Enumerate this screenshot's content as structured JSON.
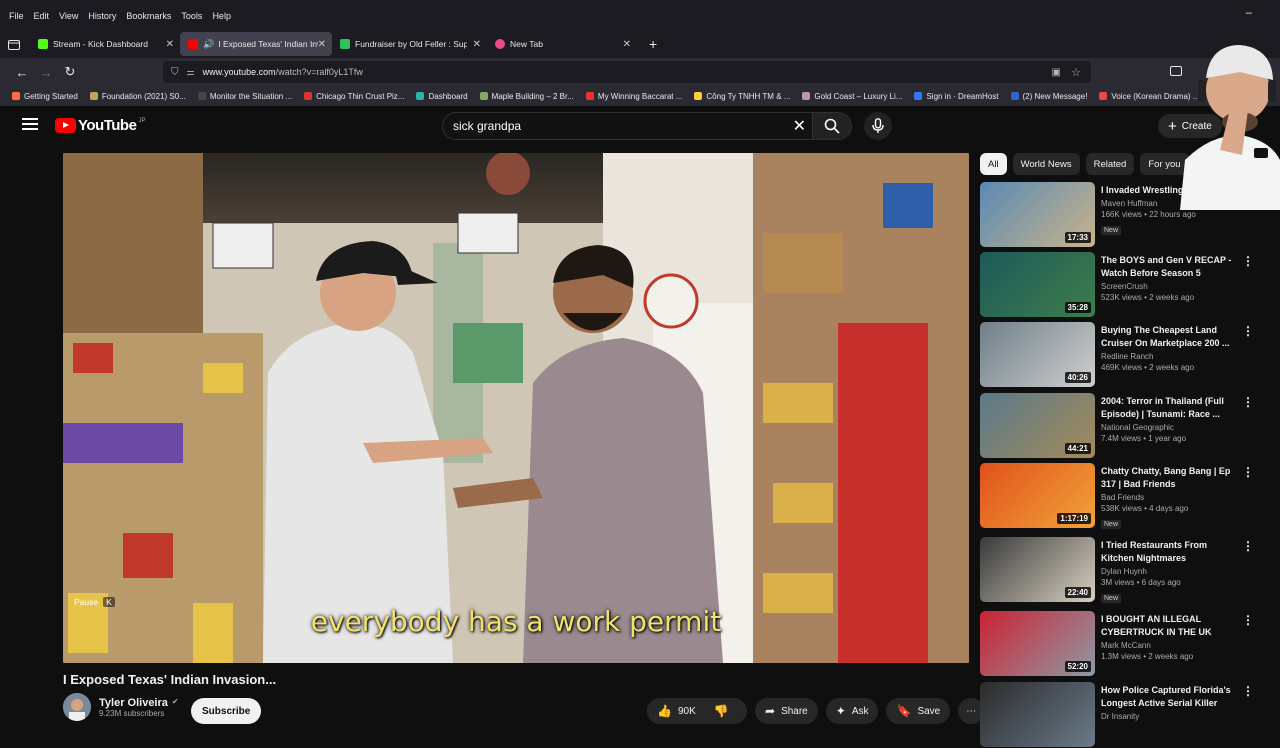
{
  "menu": [
    "File",
    "Edit",
    "View",
    "History",
    "Bookmarks",
    "Tools",
    "Help"
  ],
  "window_minimize": "–",
  "tabs": [
    {
      "label": "Stream - Kick Dashboard",
      "color": "#53fc18"
    },
    {
      "label": "I Exposed Texas' Indian Inva",
      "color": "#ff0000",
      "active": true
    },
    {
      "label": "Fundraiser by Old Feller : Supp",
      "color": "#2dc25b"
    },
    {
      "label": "New Tab",
      "color": "#e74c8b"
    }
  ],
  "url": {
    "host": "www.youtube.com",
    "path": "/watch?v=ralf0yL1Tfw"
  },
  "bookmarks": [
    {
      "label": "Getting Started",
      "color": "#ff7139"
    },
    {
      "label": "Foundation (2021) S0...",
      "color": "#c4a35a"
    },
    {
      "label": "Monitor the Situation ...",
      "color": "#444"
    },
    {
      "label": "Chicago Thin Crust Piz...",
      "color": "#d33"
    },
    {
      "label": "Dashboard",
      "color": "#2bb3a3"
    },
    {
      "label": "Maple Building – 2 Br...",
      "color": "#8a6"
    },
    {
      "label": "My Winning Baccarat ...",
      "color": "#e33"
    },
    {
      "label": "Công Ty TNHH TM & ...",
      "color": "#fc3"
    },
    {
      "label": "Gold Coast – Luxury Li...",
      "color": "#b9a"
    },
    {
      "label": "Sign in · DreamHost",
      "color": "#37f"
    },
    {
      "label": "(2) New Message!",
      "color": "#36c"
    },
    {
      "label": "Voice (Korean Drama) ...",
      "color": "#e44"
    }
  ],
  "youtube": {
    "logo_text": "YouTube",
    "country_code": "JP",
    "search_value": "sick grandpa",
    "create_label": "Create"
  },
  "video": {
    "caption": "everybody has a work permit",
    "pause_label": "Pause",
    "pause_key": "K",
    "title": "I Exposed Texas' Indian Invasion...",
    "channel": "Tyler Oliveira",
    "subscribers": "9.23M subscribers",
    "subscribe_label": "Subscribe",
    "likes": "90K",
    "share_label": "Share",
    "ask_label": "Ask",
    "save_label": "Save"
  },
  "chips": [
    "All",
    "World News",
    "Related",
    "For you"
  ],
  "recommendations": [
    {
      "title": "I Invaded Wrestling...",
      "channel": "Maven Huffman",
      "meta": "166K views • 22 hours ago",
      "badge": "New",
      "duration": "17:33",
      "colors": [
        "#5a8ab5",
        "#c9b38a"
      ]
    },
    {
      "title": "The BOYS and Gen V RECAP - Watch Before Season 5",
      "channel": "ScreenCrush",
      "meta": "523K views • 2 weeks ago",
      "badge": "",
      "duration": "35:28",
      "colors": [
        "#1e5a5a",
        "#3d7d4a"
      ]
    },
    {
      "title": "Buying The Cheapest Land Cruiser On Marketplace 200 ...",
      "channel": "Redline Ranch",
      "meta": "469K views • 2 weeks ago",
      "badge": "",
      "duration": "40:26",
      "colors": [
        "#6f7f89",
        "#cfcfcf"
      ]
    },
    {
      "title": "2004: Terror in Thailand (Full Episode) | Tsunami: Race ...",
      "channel": "National Geographic",
      "meta": "7.4M views • 1 year ago",
      "badge": "",
      "duration": "44:21",
      "colors": [
        "#5a7a8a",
        "#a58a5a"
      ]
    },
    {
      "title": "Chatty Chatty, Bang Bang | Ep 317 | Bad Friends",
      "channel": "Bad Friends",
      "meta": "538K views • 4 days ago",
      "badge": "New",
      "duration": "1:17:19",
      "colors": [
        "#e0521a",
        "#f2a33a"
      ]
    },
    {
      "title": "I Tried Restaurants From Kitchen Nightmares",
      "channel": "Dylan Huynh",
      "meta": "3M views • 6 days ago",
      "badge": "New",
      "duration": "22:40",
      "colors": [
        "#3a3a3a",
        "#d7d0c0"
      ]
    },
    {
      "title": "I BOUGHT AN ILLEGAL CYBERTRUCK IN THE UK",
      "channel": "Mark McCann",
      "meta": "1.3M views • 2 weeks ago",
      "badge": "",
      "duration": "52:20",
      "colors": [
        "#c23",
        "#8e9aa5"
      ]
    },
    {
      "title": "How Police Captured Florida's Longest Active Serial Killer",
      "channel": "Dr Insanity",
      "meta": "",
      "badge": "",
      "duration": "",
      "colors": [
        "#2b2b2b",
        "#6a7a8a"
      ]
    }
  ]
}
